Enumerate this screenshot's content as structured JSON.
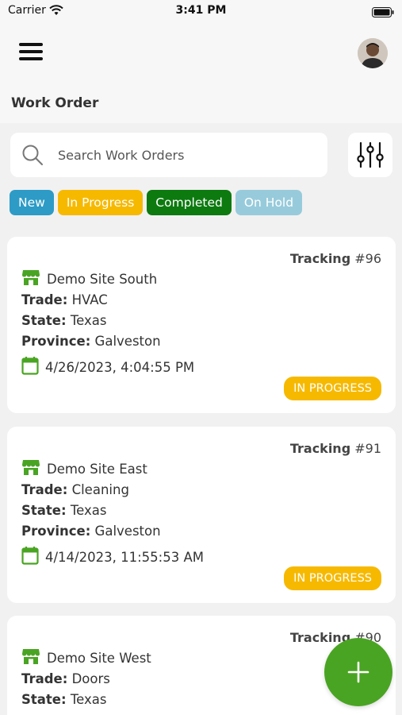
{
  "status_bar": {
    "carrier": "Carrier",
    "time": "3:41 PM"
  },
  "header": {
    "title": "Work Order"
  },
  "search": {
    "placeholder": "Search Work Orders"
  },
  "filters": [
    {
      "label": "New",
      "color": "#2d9bc6"
    },
    {
      "label": "In Progress",
      "color": "#f6b900"
    },
    {
      "label": "Completed",
      "color": "#0d7a10"
    },
    {
      "label": "On Hold",
      "color": "#97cbdb"
    }
  ],
  "colors": {
    "accent_green": "#4aa423",
    "badge_in_progress": "#f6b900"
  },
  "labels": {
    "trade": "Trade:",
    "state": "State:",
    "province": "Province:",
    "tracking": "Tracking"
  },
  "work_orders": [
    {
      "number": "#96",
      "site": "Demo Site South",
      "trade": "HVAC",
      "state": "Texas",
      "province": "Galveston",
      "date": "4/26/2023, 4:04:55 PM",
      "status": "IN PROGRESS"
    },
    {
      "number": "#91",
      "site": "Demo Site East",
      "trade": "Cleaning",
      "state": "Texas",
      "province": "Galveston",
      "date": "4/14/2023, 11:55:53 AM",
      "status": "IN PROGRESS"
    },
    {
      "number": "#90",
      "site": "Demo Site West",
      "trade": "Doors",
      "state": "Texas"
    }
  ]
}
